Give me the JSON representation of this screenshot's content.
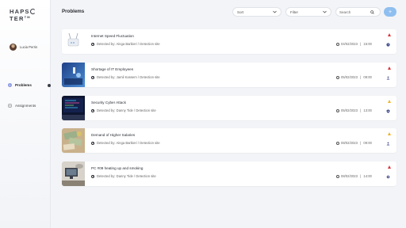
{
  "sidebar": {
    "logo_text_left": "HAPS",
    "logo_text_right": "TER",
    "logo_sup": "TM",
    "user_name": "Lucia Perrin",
    "nav": [
      {
        "label": "Problems",
        "icon": "problems-icon",
        "active": true
      },
      {
        "label": "Assignments",
        "icon": "assignments-icon",
        "active": false
      }
    ]
  },
  "header": {
    "title": "Problems",
    "sort_placeholder": "Sort",
    "filter_placeholder": "Filter",
    "search_placeholder": "Search",
    "add_label": "+"
  },
  "problems": [
    {
      "title": "Internet Speed Fluctuation",
      "meta": "Detected by: Ainga Barbieri / Detection site",
      "date": "04/02/2023",
      "time": "15:00",
      "severity_color": "#d9363e",
      "icon2": "clock-status-icon",
      "thumb": "router-image"
    },
    {
      "title": "Shortage of IT Employees",
      "meta": "Detected by: Jamil Kassem / Detection site",
      "date": "05/02/2023",
      "time": "09:00",
      "severity_color": "#d9363e",
      "icon2": "people-icon",
      "thumb": "office-image"
    },
    {
      "title": "Security Cyber Attack",
      "meta": "Detected by: Danny Tide / Detection site",
      "date": "05/02/2023",
      "time": "13:00",
      "severity_color": "#f0b429",
      "icon2": "shield-icon",
      "thumb": "code-screen-image"
    },
    {
      "title": "Demand of Higher Salaries",
      "meta": "Detected by: Ainga Barbieri / Detection site",
      "date": "08/02/2023",
      "time": "09:00",
      "severity_color": "#f0b429",
      "icon2": "people-icon",
      "thumb": "money-image"
    },
    {
      "title": "PC #09 heating up and smoking",
      "meta": "Detected by: Danny Tide / Detection site",
      "date": "08/02/2023",
      "time": "14:00",
      "severity_color": "#d9363e",
      "icon2": "gear-icon",
      "thumb": "computer-image"
    }
  ]
}
